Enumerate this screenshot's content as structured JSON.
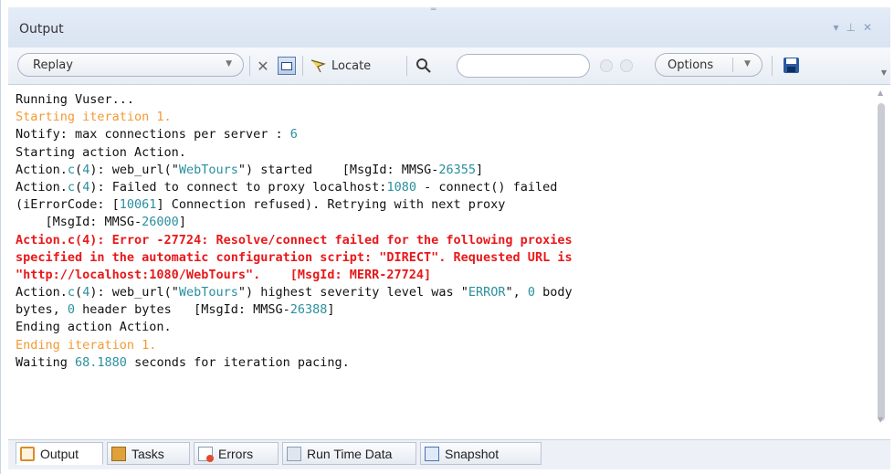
{
  "window": {
    "title": "Output"
  },
  "toolbar": {
    "replay_label": "Replay",
    "locate_label": "Locate",
    "search_value": "",
    "options_label": "Options"
  },
  "log": {
    "lines": [
      [
        {
          "t": "Running Vuser...",
          "c": ""
        }
      ],
      [
        {
          "t": "Starting iteration 1.",
          "c": "orange"
        }
      ],
      [
        {
          "t": "Notify: max connections per server : ",
          "c": ""
        },
        {
          "t": "6",
          "c": "teal"
        }
      ],
      [
        {
          "t": "Starting action Action.",
          "c": ""
        }
      ],
      [
        {
          "t": "Action.",
          "c": ""
        },
        {
          "t": "c",
          "c": "teal"
        },
        {
          "t": "(",
          "c": ""
        },
        {
          "t": "4",
          "c": "teal"
        },
        {
          "t": "): web_url(\"",
          "c": ""
        },
        {
          "t": "WebTours",
          "c": "teal"
        },
        {
          "t": "\") started    [MsgId: MMSG-",
          "c": ""
        },
        {
          "t": "26355",
          "c": "teal"
        },
        {
          "t": "]",
          "c": ""
        }
      ],
      [
        {
          "t": "Action.",
          "c": ""
        },
        {
          "t": "c",
          "c": "teal"
        },
        {
          "t": "(",
          "c": ""
        },
        {
          "t": "4",
          "c": "teal"
        },
        {
          "t": "): Failed to connect to proxy localhost:",
          "c": ""
        },
        {
          "t": "1080",
          "c": "teal"
        },
        {
          "t": " - connect() failed",
          "c": ""
        }
      ],
      [
        {
          "t": "(iErrorCode: [",
          "c": ""
        },
        {
          "t": "10061",
          "c": "teal"
        },
        {
          "t": "] Connection refused). Retrying with next proxy",
          "c": ""
        }
      ],
      [
        {
          "t": "    [MsgId: MMSG-",
          "c": ""
        },
        {
          "t": "26000",
          "c": "teal"
        },
        {
          "t": "]",
          "c": ""
        }
      ],
      [
        {
          "t": "Action.c(4): Error -27724: Resolve/connect failed for the following proxies",
          "c": "red"
        }
      ],
      [
        {
          "t": "specified in the automatic configuration script: \"DIRECT\". Requested URL is",
          "c": "red"
        }
      ],
      [
        {
          "t": "\"http://localhost:1080/WebTours\".    [MsgId: MERR-27724]",
          "c": "red"
        }
      ],
      [
        {
          "t": "Action.",
          "c": ""
        },
        {
          "t": "c",
          "c": "teal"
        },
        {
          "t": "(",
          "c": ""
        },
        {
          "t": "4",
          "c": "teal"
        },
        {
          "t": "): web_url(\"",
          "c": ""
        },
        {
          "t": "WebTours",
          "c": "teal"
        },
        {
          "t": "\") highest severity level was \"",
          "c": ""
        },
        {
          "t": "ERROR",
          "c": "teal"
        },
        {
          "t": "\", ",
          "c": ""
        },
        {
          "t": "0",
          "c": "teal"
        },
        {
          "t": " body",
          "c": ""
        }
      ],
      [
        {
          "t": "bytes, ",
          "c": ""
        },
        {
          "t": "0",
          "c": "teal"
        },
        {
          "t": " header bytes   [MsgId: MMSG-",
          "c": ""
        },
        {
          "t": "26388",
          "c": "teal"
        },
        {
          "t": "]",
          "c": ""
        }
      ],
      [
        {
          "t": "Ending action Action.",
          "c": ""
        }
      ],
      [
        {
          "t": "Ending iteration 1.",
          "c": "orange"
        }
      ],
      [
        {
          "t": "Waiting ",
          "c": ""
        },
        {
          "t": "68.1880",
          "c": "teal"
        },
        {
          "t": " seconds for iteration pacing.",
          "c": ""
        }
      ]
    ]
  },
  "tabs": [
    {
      "label": "Output",
      "icon": "output-icon",
      "active": true
    },
    {
      "label": "Tasks",
      "icon": "tasks-icon",
      "active": false
    },
    {
      "label": "Errors",
      "icon": "errors-icon",
      "active": false
    },
    {
      "label": "Run Time Data",
      "icon": "run-time-data-icon",
      "active": false
    },
    {
      "label": "Snapshot",
      "icon": "snapshot-icon",
      "active": false
    }
  ],
  "colors": {
    "warning_text": "#f39a34",
    "error_text": "#e8181a",
    "value_text": "#2a8f9e"
  }
}
